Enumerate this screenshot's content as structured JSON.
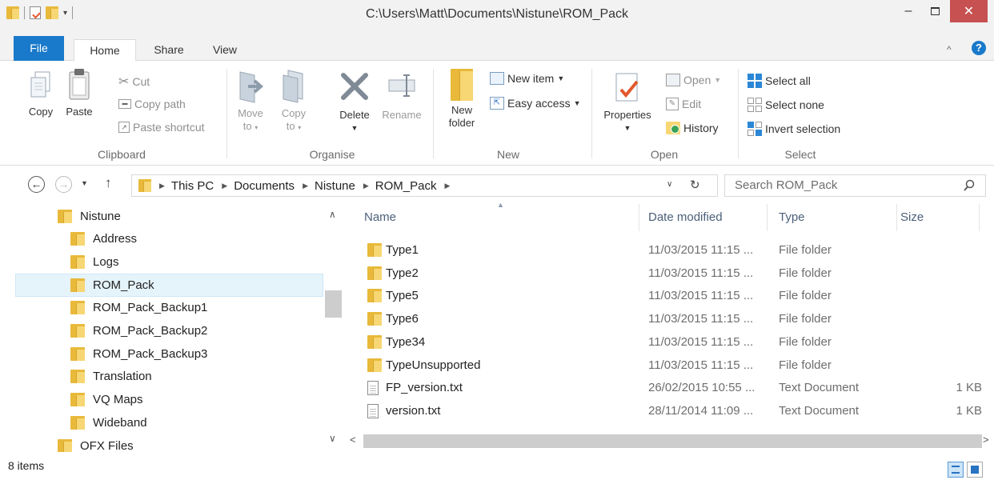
{
  "window": {
    "title": "C:\\Users\\Matt\\Documents\\Nistune\\ROM_Pack",
    "minimize_glyph": "–",
    "close_glyph": "✕"
  },
  "tabs": [
    {
      "label": "File"
    },
    {
      "label": "Home"
    },
    {
      "label": "Share"
    },
    {
      "label": "View"
    }
  ],
  "ribbon": {
    "clipboard": {
      "group_label": "Clipboard",
      "copy": "Copy",
      "paste": "Paste",
      "cut": "Cut",
      "copy_path": "Copy path",
      "paste_shortcut": "Paste shortcut"
    },
    "organise": {
      "group_label": "Organise",
      "move_to_1": "Move",
      "move_to_2": "to",
      "copy_to_1": "Copy",
      "copy_to_2": "to",
      "delete": "Delete",
      "rename": "Rename"
    },
    "new": {
      "group_label": "New",
      "new_folder_1": "New",
      "new_folder_2": "folder",
      "new_item": "New item",
      "easy_access": "Easy access"
    },
    "open": {
      "group_label": "Open",
      "properties": "Properties",
      "open": "Open",
      "edit": "Edit",
      "history": "History"
    },
    "select": {
      "group_label": "Select",
      "select_all": "Select all",
      "select_none": "Select none",
      "invert_selection": "Invert selection"
    }
  },
  "address": {
    "breadcrumbs": [
      "This PC",
      "Documents",
      "Nistune",
      "ROM_Pack"
    ],
    "search_placeholder": "Search ROM_Pack"
  },
  "nav_tree": [
    {
      "label": "Nistune",
      "level": 0
    },
    {
      "label": "Address",
      "level": 1
    },
    {
      "label": "Logs",
      "level": 1
    },
    {
      "label": "ROM_Pack",
      "level": 1,
      "selected": true
    },
    {
      "label": "ROM_Pack_Backup1",
      "level": 1
    },
    {
      "label": "ROM_Pack_Backup2",
      "level": 1
    },
    {
      "label": "ROM_Pack_Backup3",
      "level": 1
    },
    {
      "label": "Translation",
      "level": 1
    },
    {
      "label": "VQ Maps",
      "level": 1
    },
    {
      "label": "Wideband",
      "level": 1
    },
    {
      "label": "OFX Files",
      "level": 0
    }
  ],
  "columns": {
    "name": "Name",
    "date": "Date modified",
    "type": "Type",
    "size": "Size"
  },
  "files": [
    {
      "name": "Type1",
      "date": "11/03/2015 11:15 ...",
      "type": "File folder",
      "size": "",
      "icon": "folder-icon"
    },
    {
      "name": "Type2",
      "date": "11/03/2015 11:15 ...",
      "type": "File folder",
      "size": "",
      "icon": "folder-icon"
    },
    {
      "name": "Type5",
      "date": "11/03/2015 11:15 ...",
      "type": "File folder",
      "size": "",
      "icon": "folder-icon"
    },
    {
      "name": "Type6",
      "date": "11/03/2015 11:15 ...",
      "type": "File folder",
      "size": "",
      "icon": "folder-icon"
    },
    {
      "name": "Type34",
      "date": "11/03/2015 11:15 ...",
      "type": "File folder",
      "size": "",
      "icon": "folder-icon"
    },
    {
      "name": "TypeUnsupported",
      "date": "11/03/2015 11:15 ...",
      "type": "File folder",
      "size": "",
      "icon": "folder-icon"
    },
    {
      "name": "FP_version.txt",
      "date": "26/02/2015 10:55 ...",
      "type": "Text Document",
      "size": "1 KB",
      "icon": "text-file-icon"
    },
    {
      "name": "version.txt",
      "date": "28/11/2014 11:09 ...",
      "type": "Text Document",
      "size": "1 KB",
      "icon": "text-file-icon"
    }
  ],
  "status": {
    "item_count": "8 items"
  },
  "colors": {
    "accent": "#1979ca",
    "close_button": "#c75050",
    "selection": "#e5f3fb",
    "folder": "#f7d774"
  }
}
